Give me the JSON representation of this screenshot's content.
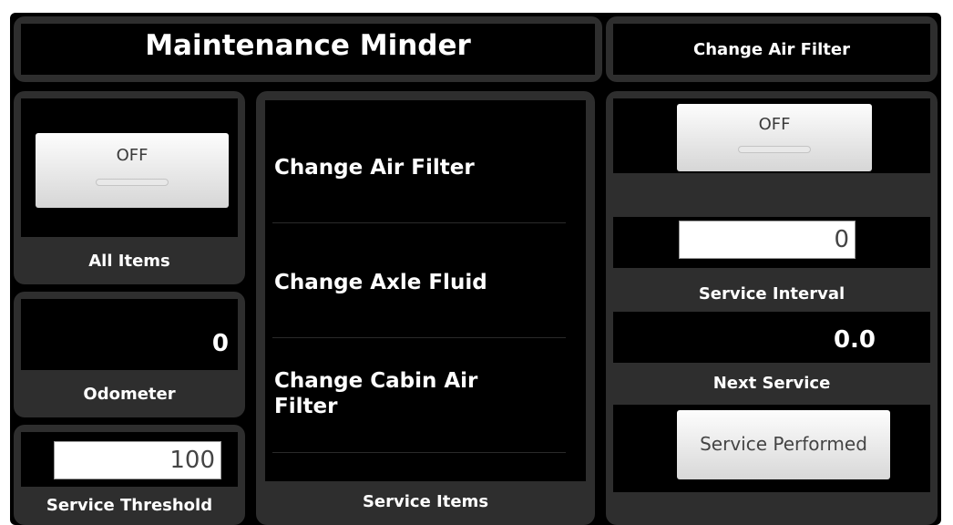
{
  "header": {
    "title": "Maintenance Minder",
    "selected_item": "Change Air Filter"
  },
  "all_items": {
    "toggle_label": "OFF",
    "label": "All Items"
  },
  "odometer": {
    "value": "0",
    "label": "Odometer"
  },
  "service_threshold": {
    "value": "100",
    "label": "Service Threshold"
  },
  "service_items": {
    "items": [
      "Change Air Filter",
      "Change Axle Fluid",
      "Change Cabin Air Filter"
    ],
    "label": "Service Items"
  },
  "detail": {
    "toggle_label": "OFF",
    "service_interval_value": "0",
    "service_interval_label": "Service Interval",
    "next_service_value": "0.0",
    "next_service_label": "Next Service",
    "service_performed_button": "Service Performed"
  }
}
